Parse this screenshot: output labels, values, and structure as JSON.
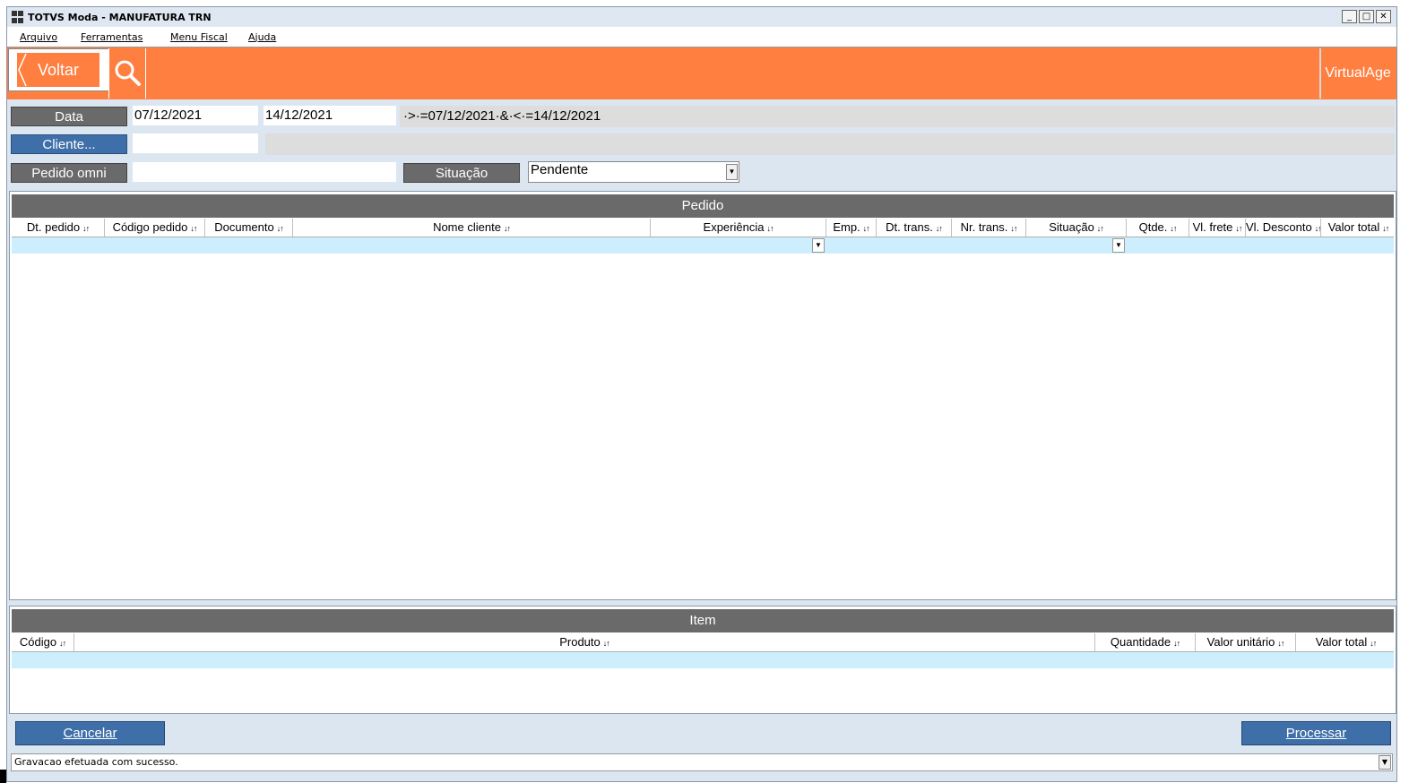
{
  "window": {
    "title": "TOTVS Moda - MANUFATURA TRN",
    "controls": {
      "minimize": "_",
      "maximize": "□",
      "close": "✕"
    }
  },
  "menu": {
    "items": [
      "Arquivo",
      "Ferramentas",
      "Menu Fiscal",
      "Ajuda"
    ]
  },
  "toolbar": {
    "back_label": "Voltar",
    "back_icon": "chevron-left-icon",
    "search_icon": "search-icon",
    "brand_label": "VirtualAge",
    "accent_color": "#ff7f40"
  },
  "filters": {
    "data_label": "Data",
    "date_from": "07/12/2021",
    "date_to": "14/12/2021",
    "date_expression": "·>·=07/12/2021·&·<·=14/12/2021",
    "cliente_label": "Cliente...",
    "cliente_value": "",
    "pedido_omni_label": "Pedido omni",
    "pedido_omni_value": "",
    "situacao_label": "Situação",
    "situacao_value": "Pendente"
  },
  "pedido_grid": {
    "title": "Pedido",
    "columns": [
      "Dt. pedido",
      "Código pedido",
      "Documento",
      "Nome cliente",
      "Experiência",
      "Emp.",
      "Dt. trans.",
      "Nr. trans.",
      "Situação",
      "Qtde.",
      "Vl. frete",
      "Vl. Desconto",
      "Valor total"
    ],
    "rows": []
  },
  "item_grid": {
    "title": "Item",
    "columns": [
      "Código",
      "Produto",
      "Quantidade",
      "Valor unitário",
      "Valor total"
    ],
    "rows": []
  },
  "actions": {
    "cancel_label": "Cancelar",
    "process_label": "Processar",
    "button_color": "#3f6fa8"
  },
  "status": {
    "message": "Gravacao efetuada com sucesso."
  },
  "sort_glyph": "↓↑"
}
